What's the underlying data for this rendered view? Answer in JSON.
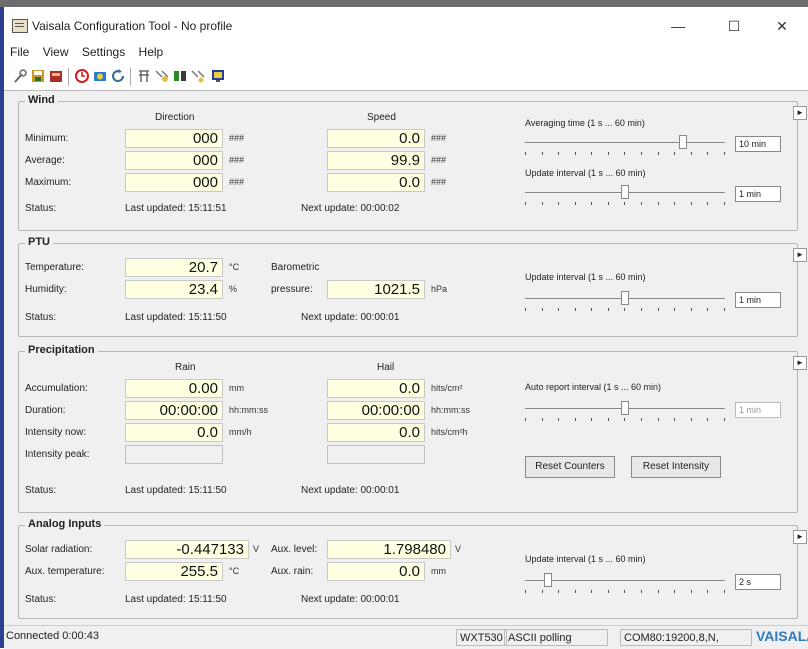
{
  "window": {
    "title": "Vaisala Configuration Tool - No profile"
  },
  "menu": [
    "File",
    "View",
    "Settings",
    "Help"
  ],
  "toolbar_icons": [
    "wrench-icon",
    "save-icon",
    "open-icon",
    "clock-icon",
    "camera-icon",
    "refresh-icon",
    "sensor-icon",
    "settings-icon",
    "connect-icon",
    "disconnect-icon",
    "monitor-icon"
  ],
  "wind": {
    "title": "Wind",
    "col_direction": "Direction",
    "col_speed": "Speed",
    "rows": [
      {
        "label": "Minimum:",
        "direction": "000",
        "dir_unit": "###",
        "speed": "0.0",
        "speed_unit": "###"
      },
      {
        "label": "Average:",
        "direction": "000",
        "dir_unit": "###",
        "speed": "99.9",
        "speed_unit": "###"
      },
      {
        "label": "Maximum:",
        "direction": "000",
        "dir_unit": "###",
        "speed": "0.0",
        "speed_unit": "###"
      }
    ],
    "status_label": "Status:",
    "last_updated": "Last updated: 15:11:51",
    "next_update": "Next update: 00:00:02",
    "avg_label": "Averaging time (1 s ... 60 min)",
    "avg_value": "10 min",
    "avg_level": 0.8,
    "upd_label": "Update interval (1 s ... 60 min)",
    "upd_value": "1 min",
    "upd_level": 0.5
  },
  "ptu": {
    "title": "PTU",
    "temp_label": "Temperature:",
    "temp_value": "20.7",
    "temp_unit": "°C",
    "hum_label": "Humidity:",
    "hum_value": "23.4",
    "hum_unit": "%",
    "baro_label1": "Barometric",
    "baro_label2": "pressure:",
    "baro_value": "1021.5",
    "baro_unit": "hPa",
    "status_label": "Status:",
    "last_updated": "Last updated: 15:11:50",
    "next_update": "Next update: 00:00:01",
    "upd_label": "Update interval (1 s ... 60 min)",
    "upd_value": "1 min",
    "upd_level": 0.5
  },
  "precip": {
    "title": "Precipitation",
    "col_rain": "Rain",
    "col_hail": "Hail",
    "rows": [
      {
        "label": "Accumulation:",
        "rain": "0.00",
        "rain_unit": "mm",
        "hail": "0.0",
        "hail_unit": "hits/cm²"
      },
      {
        "label": "Duration:",
        "rain": "00:00:00",
        "rain_unit": "hh:mm:ss",
        "hail": "00:00:00",
        "hail_unit": "hh:mm:ss"
      },
      {
        "label": "Intensity now:",
        "rain": "0.0",
        "rain_unit": "mm/h",
        "hail": "0.0",
        "hail_unit": "hits/cm²h"
      },
      {
        "label": "Intensity peak:",
        "rain": "",
        "rain_unit": "",
        "hail": "",
        "hail_unit": ""
      }
    ],
    "status_label": "Status:",
    "last_updated": "Last updated: 15:11:50",
    "next_update": "Next update: 00:00:01",
    "auto_label": "Auto report interval (1 s ... 60 min)",
    "auto_value": "1 min",
    "auto_level": 0.5,
    "reset_counters": "Reset Counters",
    "reset_intensity": "Reset Intensity"
  },
  "analog": {
    "title": "Analog Inputs",
    "solar_label": "Solar radiation:",
    "solar_value": "-0.447133",
    "solar_unit": "V",
    "auxlevel_label": "Aux. level:",
    "auxlevel_value": "1.798480",
    "auxlevel_unit": "V",
    "auxtemp_label": "Aux. temperature:",
    "auxtemp_value": "255.5",
    "auxtemp_unit": "°C",
    "auxrain_label": "Aux. rain:",
    "auxrain_value": "0.0",
    "auxrain_unit": "mm",
    "status_label": "Status:",
    "last_updated": "Last updated: 15:11:50",
    "next_update": "Next update: 00:00:01",
    "upd_label": "Update interval (1 s ... 60 min)",
    "upd_value": "2 s",
    "upd_level": 0.1
  },
  "status": {
    "connection": "Connected 0:00:43",
    "device": "WXT530",
    "mode": "ASCII polling",
    "port": "COM80:19200,8,N,",
    "brand": "VAISALA"
  }
}
